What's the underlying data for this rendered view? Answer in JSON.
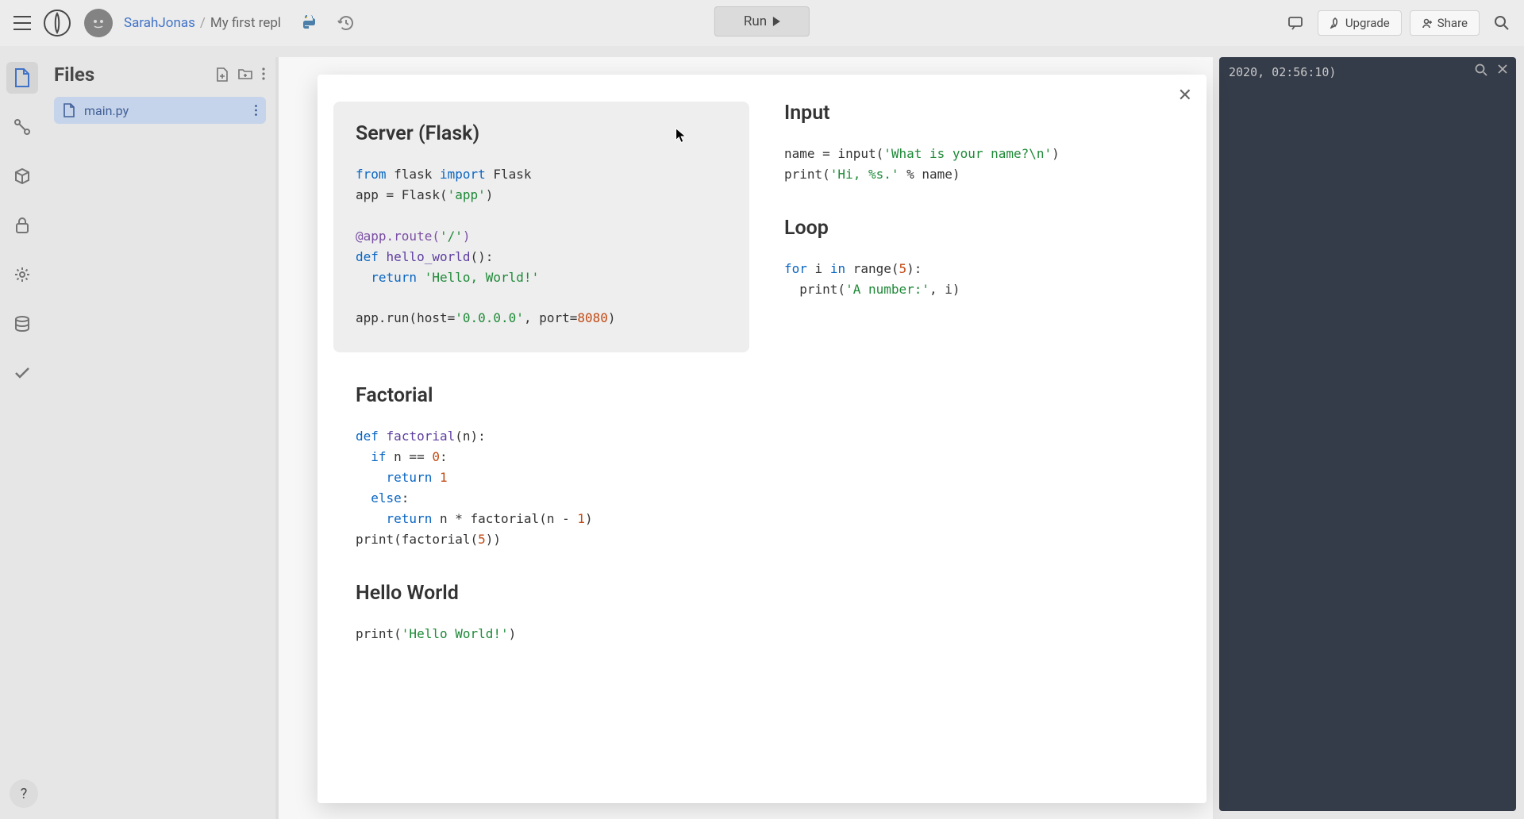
{
  "header": {
    "user": "SarahJonas",
    "repl_name": "My first repl",
    "run_label": "Run",
    "upgrade_label": "Upgrade",
    "share_label": "Share"
  },
  "files": {
    "panel_title": "Files",
    "active_file": "main.py"
  },
  "console": {
    "text": "2020, 02:56:10)"
  },
  "help": {
    "label": "?"
  },
  "modal": {
    "examples": {
      "server": {
        "title": "Server (Flask)",
        "code_plain": "from flask import Flask\napp = Flask('app')\n\n@app.route('/')\ndef hello_world():\n  return 'Hello, World!'\n\napp.run(host='0.0.0.0', port=8080)"
      },
      "input": {
        "title": "Input",
        "code_plain": "name = input('What is your name?\\n')\nprint('Hi, %s.' % name)"
      },
      "loop": {
        "title": "Loop",
        "code_plain": "for i in range(5):\n  print('A number:', i)"
      },
      "factorial": {
        "title": "Factorial",
        "code_plain": "def factorial(n):\n  if n == 0:\n    return 1\n  else:\n    return n * factorial(n - 1)\nprint(factorial(5))"
      },
      "hello": {
        "title": "Hello World",
        "code_plain": "print('Hello World!')"
      }
    }
  }
}
